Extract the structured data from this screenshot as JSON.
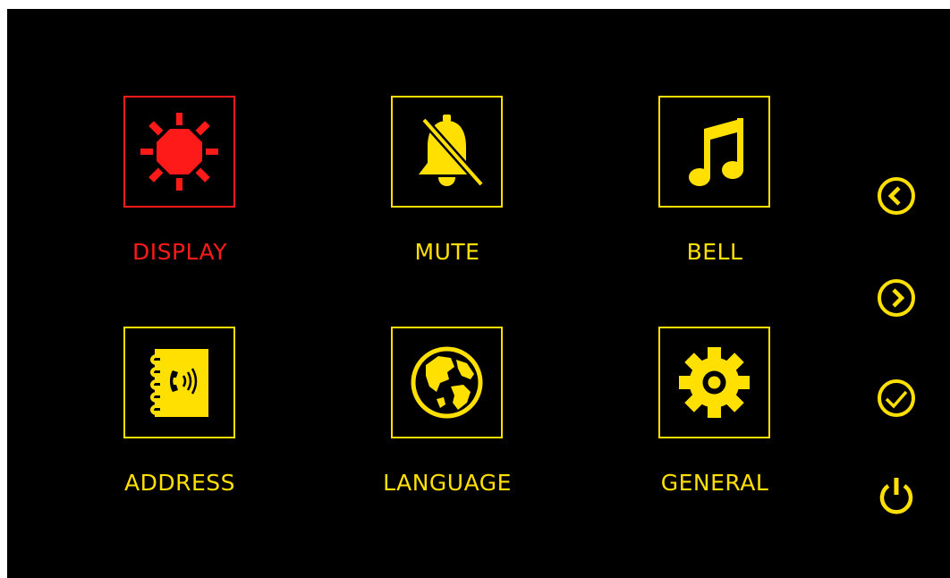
{
  "colors": {
    "background": "#000000",
    "accent": "#ffe000",
    "selected": "#ff1a1a"
  },
  "menu": {
    "selected": "display",
    "items": [
      {
        "id": "display",
        "label": "DISPLAY",
        "icon": "sun-icon"
      },
      {
        "id": "mute",
        "label": "MUTE",
        "icon": "bell-muted-icon"
      },
      {
        "id": "bell",
        "label": "BELL",
        "icon": "music-note-icon"
      },
      {
        "id": "address",
        "label": "ADDRESS",
        "icon": "address-book-icon"
      },
      {
        "id": "language",
        "label": "LANGUAGE",
        "icon": "globe-icon"
      },
      {
        "id": "general",
        "label": "GENERAL",
        "icon": "gear-icon"
      }
    ]
  },
  "side_controls": [
    {
      "id": "prev",
      "icon": "chevron-left-circle-icon"
    },
    {
      "id": "next",
      "icon": "chevron-right-circle-icon"
    },
    {
      "id": "confirm",
      "icon": "check-circle-icon"
    },
    {
      "id": "power",
      "icon": "power-icon"
    }
  ]
}
